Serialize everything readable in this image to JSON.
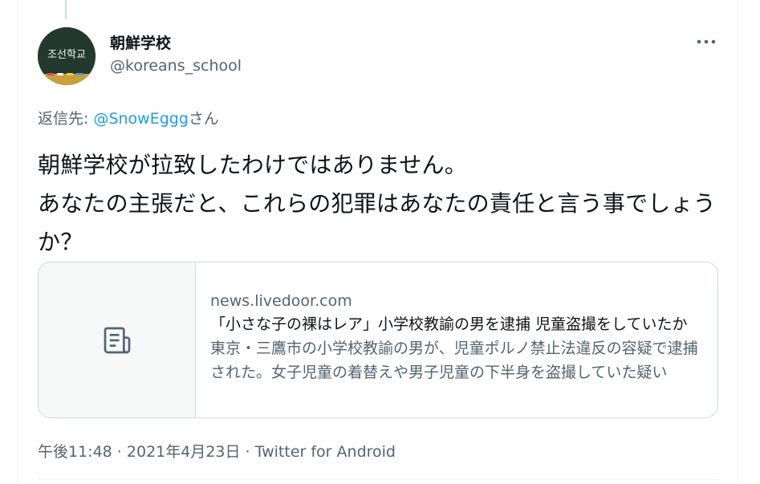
{
  "author": {
    "display_name": "朝鮮学校",
    "handle": "@koreans_school",
    "avatar_text": "조선학교"
  },
  "reply_to": {
    "prefix": "返信先: ",
    "mention": "@SnowEggg",
    "suffix": "さん"
  },
  "tweet": {
    "text": "朝鮮学校が拉致したわけではありません。\nあなたの主張だと、これらの犯罪はあなたの責任と言う事でしょうか？"
  },
  "link_card": {
    "icon": "article-icon",
    "domain": "news.livedoor.com",
    "title": "「小さな子の裸はレア」小学校教諭の男を逮捕 児童盗撮をしていたか",
    "description": "東京・三鷹市の小学校教諭の男が、児童ポルノ禁止法違反の容疑で逮捕された。女子児童の着替えや男子児童の下半身を盗撮していた疑い"
  },
  "meta": {
    "time": "午後11:48",
    "sep1": " · ",
    "date": "2021年4月23日",
    "sep2": " · ",
    "source": "Twitter for Android"
  },
  "icons": {
    "more": "more-icon"
  },
  "colors": {
    "link": "#1d9bf0",
    "secondary": "#536471",
    "border": "#cfd9de"
  }
}
